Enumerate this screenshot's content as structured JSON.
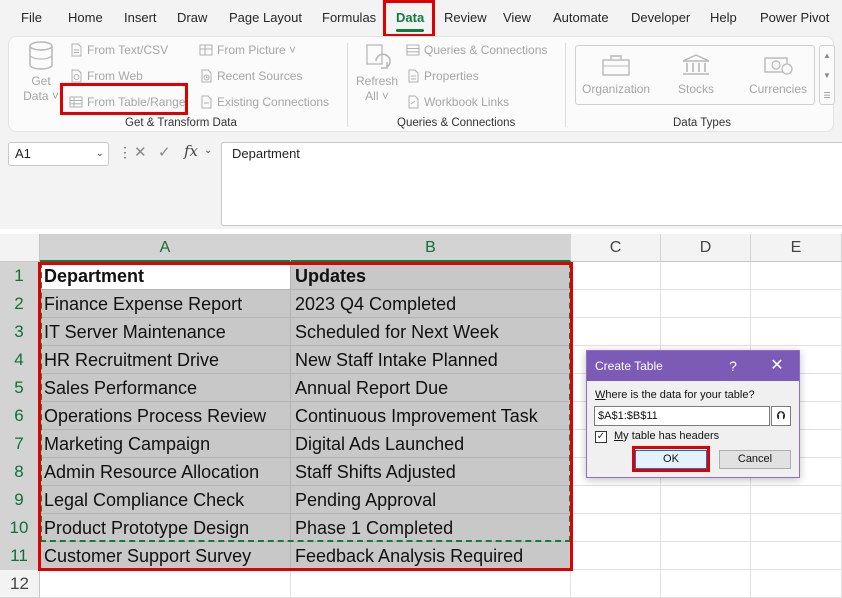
{
  "menu": {
    "tabs": [
      "File",
      "Home",
      "Insert",
      "Draw",
      "Page Layout",
      "Formulas",
      "Data",
      "Review",
      "View",
      "Automate",
      "Developer",
      "Help",
      "Power Pivot"
    ],
    "active_tab": "Data"
  },
  "ribbon": {
    "get_data": {
      "line1": "Get",
      "line2": "Data ˅"
    },
    "get_transform": {
      "items": [
        "From Text/CSV",
        "From Web",
        "From Table/Range",
        "From Picture ˅",
        "Recent Sources",
        "Existing Connections"
      ],
      "label": "Get & Transform Data"
    },
    "queries": {
      "refresh_line1": "Refresh",
      "refresh_line2": "All ˅",
      "items": [
        "Queries & Connections",
        "Properties",
        "Workbook Links"
      ],
      "label": "Queries & Connections"
    },
    "data_types": {
      "items": [
        "Organization",
        "Stocks",
        "Currencies"
      ],
      "label": "Data Types"
    }
  },
  "formula_bar": {
    "name_box": "A1",
    "formula": "Department"
  },
  "sheet": {
    "columns": [
      "A",
      "B",
      "C",
      "D",
      "E"
    ],
    "rows": [
      "1",
      "2",
      "3",
      "4",
      "5",
      "6",
      "7",
      "8",
      "9",
      "10",
      "11",
      "12"
    ],
    "cells": [
      [
        "Department",
        "Updates"
      ],
      [
        "Finance Expense Report",
        "2023 Q4 Completed"
      ],
      [
        "IT Server Maintenance",
        "Scheduled for Next Week"
      ],
      [
        "HR Recruitment Drive",
        "New Staff Intake Planned"
      ],
      [
        "Sales Performance",
        "Annual Report Due"
      ],
      [
        "Operations Process Review",
        "Continuous Improvement Task"
      ],
      [
        "Marketing Campaign",
        "Digital Ads Launched"
      ],
      [
        "Admin Resource Allocation",
        "Staff Shifts Adjusted"
      ],
      [
        "Legal Compliance Check",
        "Pending Approval"
      ],
      [
        "Product Prototype Design",
        "Phase 1 Completed"
      ],
      [
        "Customer Support Survey",
        "Feedback Analysis Required"
      ]
    ]
  },
  "dialog": {
    "title": "Create Table",
    "help": "?",
    "close": "✕",
    "prompt": "Where is the data for your table?",
    "range": "$A$1:$B$11",
    "has_headers_label": "My table has headers",
    "has_headers": true,
    "ok": "OK",
    "cancel": "Cancel"
  },
  "colors": {
    "accent": "#107c41",
    "dialog_title": "#7b5bb6",
    "highlight": "#e00000"
  }
}
